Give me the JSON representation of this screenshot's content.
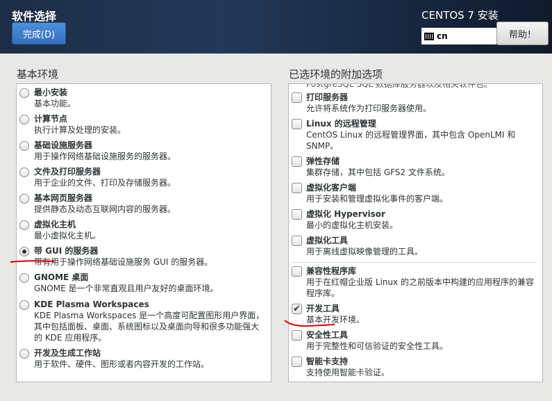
{
  "header": {
    "title": "软件选择",
    "done_label": "完成(D)",
    "product": "CENTOS 7 安装",
    "keyboard": "cn",
    "help_label": "帮助！"
  },
  "base": {
    "heading": "基本环境",
    "items": [
      {
        "name": "最小安装",
        "desc": "基本功能。",
        "selected": false
      },
      {
        "name": "计算节点",
        "desc": "执行计算及处理的安装。",
        "selected": false
      },
      {
        "name": "基础设施服务器",
        "desc": "用于操作网络基础设施服务的服务器。",
        "selected": false
      },
      {
        "name": "文件及打印服务器",
        "desc": "用于企业的文件、打印及存储服务器。",
        "selected": false
      },
      {
        "name": "基本网页服务器",
        "desc": "提供静态及动态互联网内容的服务器。",
        "selected": false
      },
      {
        "name": "虚拟化主机",
        "desc": "最小虚拟化主机。",
        "selected": false
      },
      {
        "name": "带 GUI 的服务器",
        "desc": "带有用于操作网络基础设施服务 GUI 的服务器。",
        "selected": true
      },
      {
        "name": "GNOME 桌面",
        "desc": "GNOME 是一个非常直观且用户友好的桌面环境。",
        "selected": false
      },
      {
        "name": "KDE Plasma Workspaces",
        "desc": "KDE Plasma Workspaces 是一个高度可配置图形用户界面，其中包括面板、桌面、系统图标以及桌面向导和很多功能强大的 KDE 应用程序。",
        "selected": false
      },
      {
        "name": "开发及生成工作站",
        "desc": "用于软件、硬件、图形或者内容开发的工作站。",
        "selected": false
      }
    ]
  },
  "addons": {
    "heading": "已选环境的附加选项",
    "cut_text": "PostgreSQL SQL 数据库服务器以及相关软件包。",
    "items": [
      {
        "name": "打印服务器",
        "desc": "允许将系统作为打印服务器使用。",
        "checked": false
      },
      {
        "name": "Linux 的远程管理",
        "desc": "CentOS Linux 的远程管理界面，其中包含 OpenLMI 和 SNMP。",
        "checked": false
      },
      {
        "name": "弹性存储",
        "desc": "集群存储，其中包括 GFS2 文件系统。",
        "checked": false
      },
      {
        "name": "虚拟化客户端",
        "desc": "用于安装和管理虚拟化事件的客户端。",
        "checked": false
      },
      {
        "name": "虚拟化 Hypervisor",
        "desc": "最小的虚拟化主机安装。",
        "checked": false
      },
      {
        "name": "虚拟化工具",
        "desc": "用于离线虚拟映像管理的工具。",
        "checked": false
      },
      {
        "name": "兼容性程序库",
        "desc": "用于在红帽企业版 Linux 的之前版本中构建的应用程序的兼容程序库。",
        "checked": false
      },
      {
        "name": "开发工具",
        "desc": "基本开发环境。",
        "checked": true
      },
      {
        "name": "安全性工具",
        "desc": "用于完整性和可信验证的安全性工具。",
        "checked": false
      },
      {
        "name": "智能卡支持",
        "desc": "支持使用智能卡验证。",
        "checked": false
      }
    ]
  },
  "colors": {
    "accent": "#3b7fcc",
    "annotation": "#e00000"
  }
}
